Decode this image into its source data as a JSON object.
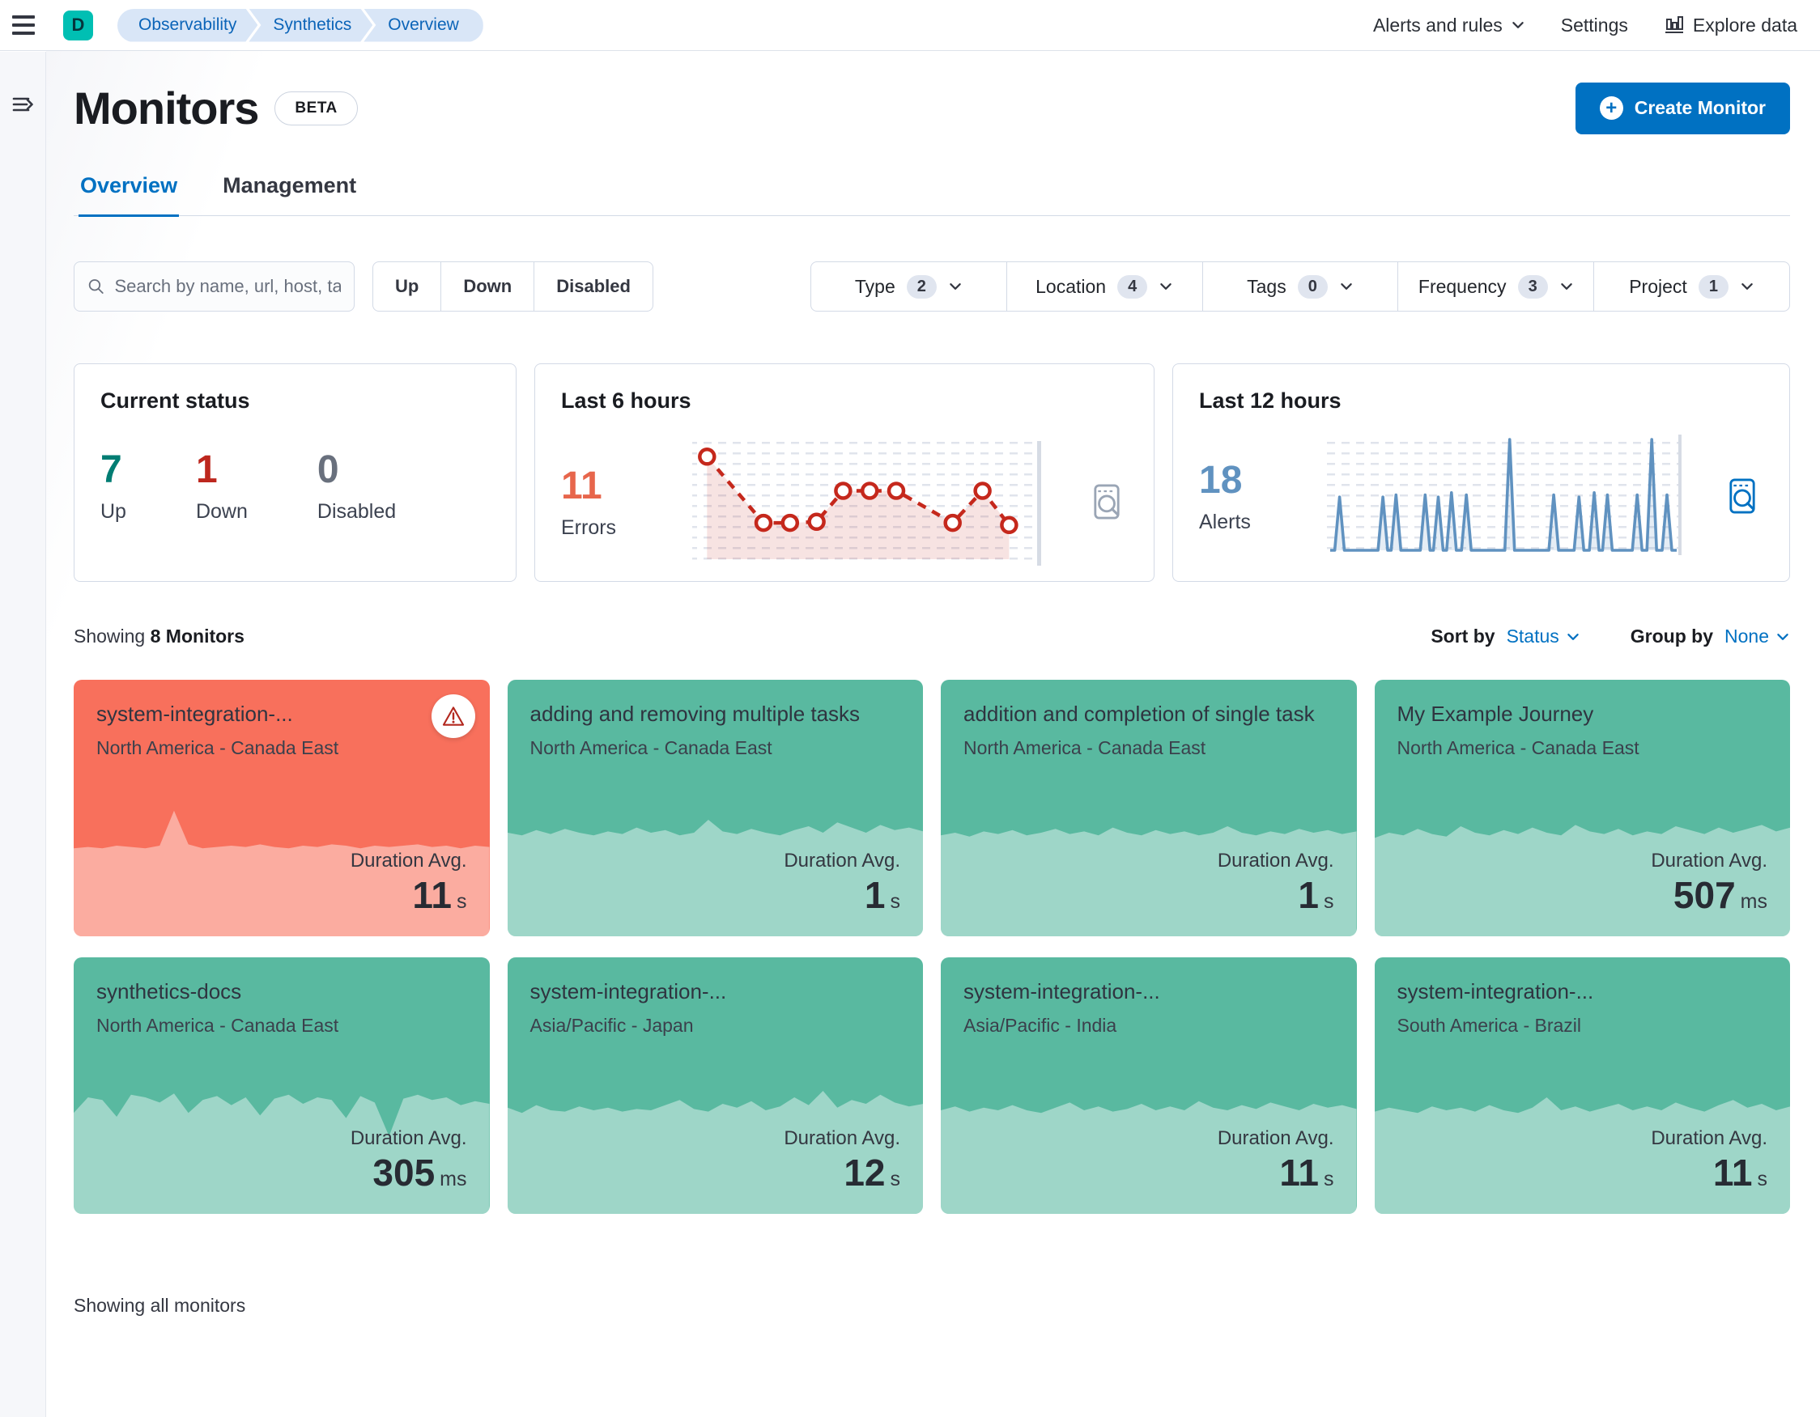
{
  "colors": {
    "primary": "#0071c2",
    "breadcrumb_bg": "#d9e6f7",
    "breadcrumb_text": "#0b64b8",
    "avatar_bg": "#00bfb3",
    "up_text": "#017d73",
    "down_text": "#bd271e",
    "disabled_text": "#69707d",
    "errors_accent": "#e7664c",
    "errors_line": "#c5281c",
    "alerts_accent": "#6092c0",
    "monitor_up_bg": "#59b9a0",
    "monitor_down_bg": "#f8705c"
  },
  "header": {
    "avatar": "D",
    "breadcrumbs": [
      "Observability",
      "Synthetics",
      "Overview"
    ],
    "actions": {
      "alerts": "Alerts and rules",
      "settings": "Settings",
      "explore": "Explore data"
    }
  },
  "page": {
    "title": "Monitors",
    "beta": "BETA",
    "create_button": "Create Monitor",
    "tabs": [
      {
        "label": "Overview"
      },
      {
        "label": "Management"
      }
    ],
    "showing_prefix": "Showing",
    "monitor_count": "8 Monitors",
    "sort_by_label": "Sort by",
    "sort_by_value": "Status",
    "group_by_label": "Group by",
    "group_by_value": "None",
    "footer": "Showing all monitors"
  },
  "filters": {
    "search_placeholder": "Search by name, url, host, ta",
    "status_buttons": [
      "Up",
      "Down",
      "Disabled"
    ],
    "dropdowns": [
      {
        "label": "Type",
        "count": "2"
      },
      {
        "label": "Location",
        "count": "4"
      },
      {
        "label": "Tags",
        "count": "0"
      },
      {
        "label": "Frequency",
        "count": "3"
      },
      {
        "label": "Project",
        "count": "1"
      }
    ]
  },
  "status_cards": {
    "current": {
      "title": "Current status",
      "items": [
        {
          "value": "7",
          "label": "Up"
        },
        {
          "value": "1",
          "label": "Down"
        },
        {
          "value": "0",
          "label": "Disabled"
        }
      ]
    },
    "errors": {
      "title": "Last 6 hours"
    },
    "alerts": {
      "title": "Last 12 hours"
    }
  },
  "chart_data": [
    {
      "type": "line",
      "title": "Last 6 hours",
      "metric": {
        "value": "11",
        "label": "Errors"
      },
      "x_normalized": [
        0.03,
        0.2,
        0.28,
        0.36,
        0.44,
        0.52,
        0.6,
        0.77,
        0.86,
        0.94
      ],
      "values": [
        9.6,
        3.4,
        3.4,
        3.5,
        6.4,
        6.4,
        6.4,
        3.4,
        6.4,
        3.2
      ],
      "ylim": [
        0,
        10
      ],
      "style": "dashed red line, open circle markers, shaded area, dotted grid background",
      "color": "#c5281c"
    },
    {
      "type": "area",
      "title": "Last 12 hours",
      "metric": {
        "value": "18",
        "label": "Alerts"
      },
      "peaks": [
        [
          0.027,
          0.48
        ],
        [
          0.152,
          0.48
        ],
        [
          0.19,
          0.5
        ],
        [
          0.274,
          0.5
        ],
        [
          0.312,
          0.48
        ],
        [
          0.35,
          0.52
        ],
        [
          0.393,
          0.5
        ],
        [
          0.518,
          1.0
        ],
        [
          0.645,
          0.5
        ],
        [
          0.718,
          0.48
        ],
        [
          0.762,
          0.52
        ],
        [
          0.8,
          0.5
        ],
        [
          0.886,
          0.5
        ],
        [
          0.928,
          1.0
        ],
        [
          0.972,
          0.5
        ]
      ],
      "ylim": [
        0,
        1
      ],
      "style": "blue spiky line with light fill, dotted grid background",
      "color": "#6092c0"
    }
  ],
  "monitors": [
    {
      "title": "system-integration-...",
      "location": "North America - Canada East",
      "duration": "11",
      "unit": "s",
      "status": "down",
      "warning": true,
      "spark": [
        0.68,
        0.69,
        0.68,
        0.7,
        0.69,
        0.68,
        0.7,
        0.97,
        0.71,
        0.68,
        0.69,
        0.7,
        0.69,
        0.71,
        0.69,
        0.68,
        0.7,
        0.69,
        0.71,
        0.7,
        0.68,
        0.7,
        0.69,
        0.7,
        0.71,
        0.69,
        0.7,
        0.68,
        0.7,
        0.69
      ]
    },
    {
      "title": "adding and removing multiple tasks",
      "location": "North America - Canada East",
      "duration": "1",
      "unit": "s",
      "status": "up",
      "warning": false,
      "spark": [
        0.8,
        0.78,
        0.82,
        0.79,
        0.83,
        0.8,
        0.78,
        0.81,
        0.79,
        0.84,
        0.8,
        0.82,
        0.78,
        0.8,
        0.9,
        0.81,
        0.79,
        0.83,
        0.8,
        0.78,
        0.82,
        0.85,
        0.8,
        0.88,
        0.84,
        0.8,
        0.86,
        0.82,
        0.84,
        0.81
      ]
    },
    {
      "title": "addition and completion of single task",
      "location": "North America - Canada East",
      "duration": "1",
      "unit": "s",
      "status": "up",
      "warning": false,
      "spark": [
        0.78,
        0.8,
        0.77,
        0.81,
        0.79,
        0.82,
        0.78,
        0.8,
        0.83,
        0.79,
        0.81,
        0.78,
        0.84,
        0.8,
        0.78,
        0.82,
        0.79,
        0.81,
        0.78,
        0.8,
        0.85,
        0.8,
        0.78,
        0.81,
        0.79,
        0.83,
        0.8,
        0.82,
        0.79,
        0.81
      ]
    },
    {
      "title": "My Example Journey",
      "location": "North America - Canada East",
      "duration": "507",
      "unit": "ms",
      "status": "up",
      "warning": false,
      "spark": [
        0.76,
        0.8,
        0.78,
        0.83,
        0.79,
        0.77,
        0.85,
        0.8,
        0.78,
        0.82,
        0.79,
        0.84,
        0.8,
        0.78,
        0.86,
        0.81,
        0.79,
        0.83,
        0.78,
        0.81,
        0.79,
        0.85,
        0.82,
        0.79,
        0.84,
        0.8,
        0.83,
        0.86,
        0.81,
        0.84
      ]
    },
    {
      "title": "synthetics-docs",
      "location": "North America - Canada East",
      "duration": "305",
      "unit": "ms",
      "status": "up",
      "warning": false,
      "spark": [
        0.78,
        0.9,
        0.88,
        0.75,
        0.92,
        0.9,
        0.86,
        0.93,
        0.78,
        0.88,
        0.91,
        0.84,
        0.9,
        0.76,
        0.89,
        0.92,
        0.85,
        0.9,
        0.88,
        0.74,
        0.91,
        0.86,
        0.6,
        0.89,
        0.92,
        0.88,
        0.9,
        0.84,
        0.87,
        0.85
      ]
    },
    {
      "title": "system-integration-...",
      "location": "Asia/Pacific - Japan",
      "duration": "12",
      "unit": "s",
      "status": "up",
      "warning": false,
      "spark": [
        0.82,
        0.78,
        0.84,
        0.8,
        0.79,
        0.83,
        0.8,
        0.82,
        0.79,
        0.81,
        0.8,
        0.84,
        0.88,
        0.81,
        0.79,
        0.85,
        0.82,
        0.87,
        0.8,
        0.83,
        0.9,
        0.84,
        0.95,
        0.82,
        0.88,
        0.85,
        0.92,
        0.86,
        0.83,
        0.85
      ]
    },
    {
      "title": "system-integration-...",
      "location": "Asia/Pacific - India",
      "duration": "11",
      "unit": "s",
      "status": "up",
      "warning": false,
      "spark": [
        0.8,
        0.83,
        0.79,
        0.82,
        0.8,
        0.84,
        0.8,
        0.78,
        0.82,
        0.86,
        0.8,
        0.83,
        0.79,
        0.81,
        0.85,
        0.8,
        0.83,
        0.8,
        0.87,
        0.82,
        0.8,
        0.84,
        0.81,
        0.86,
        0.83,
        0.8,
        0.85,
        0.82,
        0.84,
        0.81
      ]
    },
    {
      "title": "system-integration-...",
      "location": "South America - Brazil",
      "duration": "11",
      "unit": "s",
      "status": "up",
      "warning": false,
      "spark": [
        0.79,
        0.82,
        0.8,
        0.78,
        0.83,
        0.8,
        0.82,
        0.79,
        0.84,
        0.8,
        0.78,
        0.82,
        0.9,
        0.8,
        0.83,
        0.79,
        0.82,
        0.85,
        0.8,
        0.83,
        0.8,
        0.86,
        0.82,
        0.79,
        0.84,
        0.88,
        0.82,
        0.85,
        0.8,
        0.83
      ]
    }
  ]
}
